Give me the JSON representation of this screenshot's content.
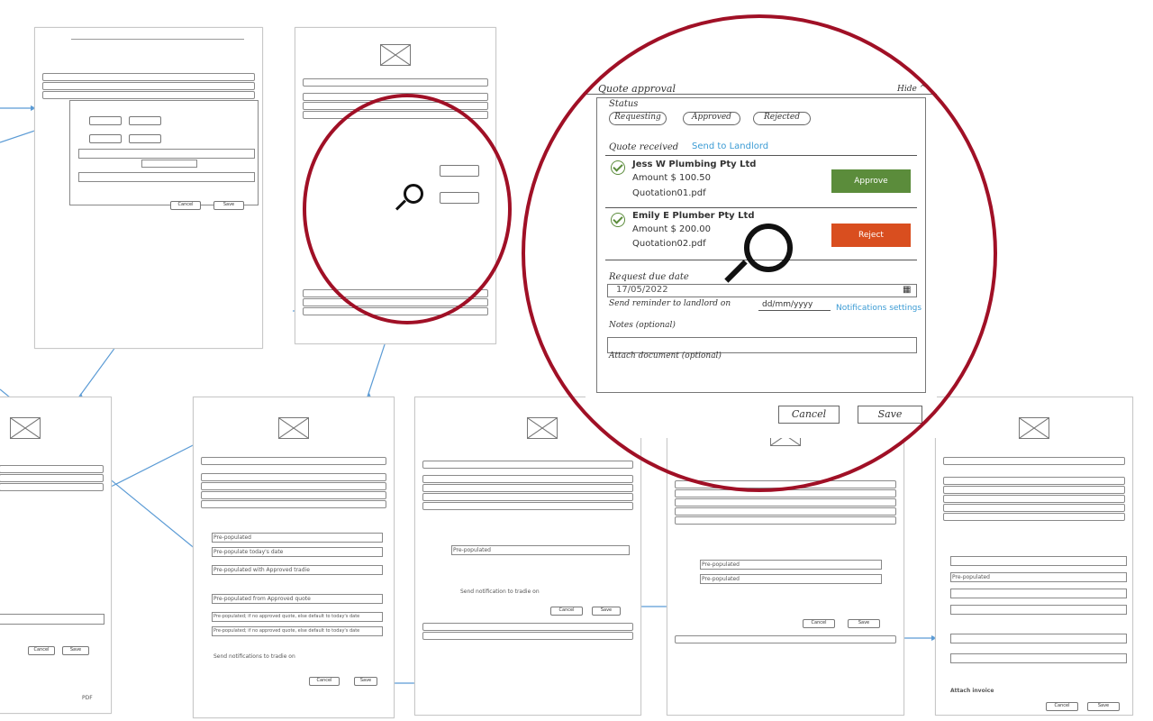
{
  "panel": {
    "title": "Quote approval",
    "hide": "Hide ^",
    "status_label": "Status",
    "status_options": [
      "Requesting",
      "Approved",
      "Rejected"
    ],
    "quote_received_label": "Quote received",
    "send_to_landlord": "Send to Landlord",
    "quotes": [
      {
        "company": "Jess W Plumbing Pty Ltd",
        "amount": "Amount $ 100.50",
        "file": "Quotation01.pdf",
        "action": "Approve"
      },
      {
        "company": "Emily E Plumber Pty Ltd",
        "amount": "Amount $ 200.00",
        "file": "Quotation02.pdf",
        "action": "Reject"
      }
    ],
    "request_due_date_label": "Request due date",
    "request_due_date_value": "17/05/2022",
    "reminder_label": "Send reminder to landlord on",
    "date_placeholder": "dd/mm/yyyy",
    "notifications_settings": "Notifications settings",
    "notes_label": "Notes (optional)",
    "attach_label": "Attach document (optional)",
    "cancel": "Cancel",
    "save": "Save"
  },
  "wireframes": {
    "pre_populated": "Pre-populated",
    "pre_populated_today": "Pre-populate today's date",
    "pre_populated_approved_tradie": "Pre-populated with Approved tradie",
    "pre_populated_quote": "Pre-populated from Approved quote",
    "pre_populated_date": "Pre-populated; if no approved quote, else default to today's date",
    "send_notifications_tradie": "Send notifications to tradie on",
    "send_notification_tradie": "Send notification to tradie on",
    "attach_invoice": "Attach invoice",
    "pdf": "PDF",
    "cancel": "Cancel",
    "save": "Save",
    "approve": "Approve",
    "reject": "Reject"
  },
  "colors": {
    "accent_ring": "#a01026",
    "approve": "#5b8c3b",
    "reject": "#d94e1f",
    "link": "#3b9bd4",
    "arrow": "#5b9bd5"
  }
}
